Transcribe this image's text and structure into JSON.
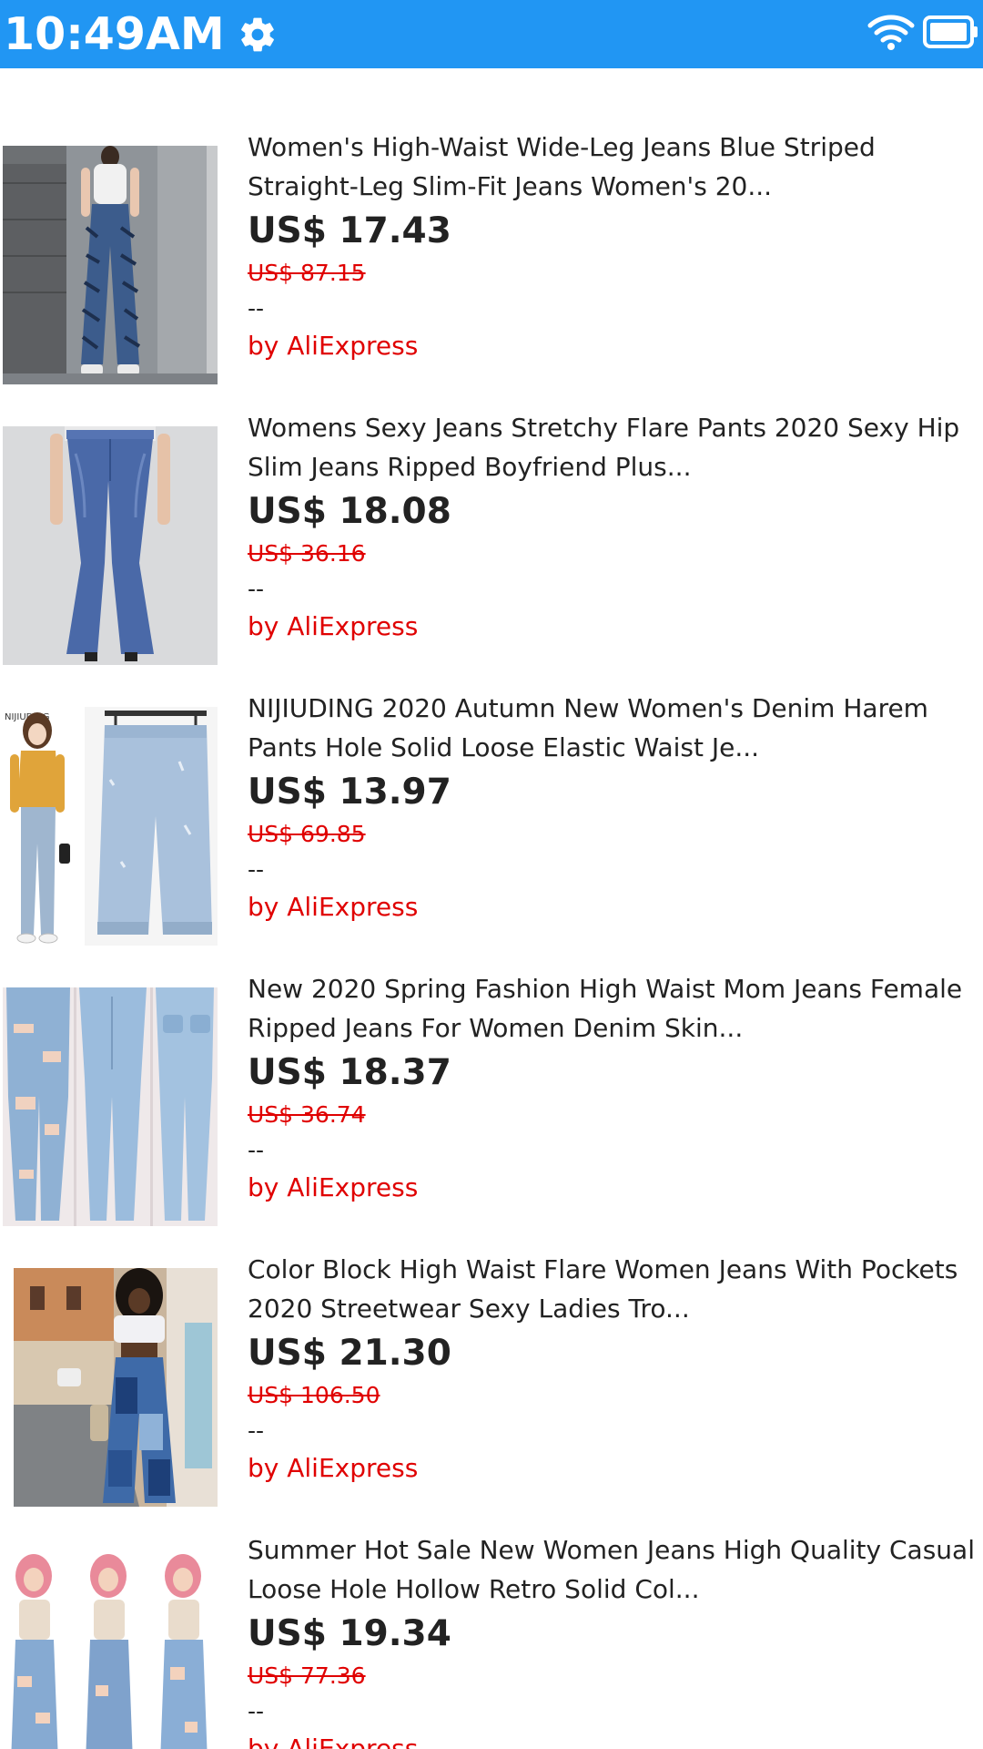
{
  "status_bar": {
    "time": "10:49AM",
    "color": "#2196F3"
  },
  "products": [
    {
      "title": "Women's High-Waist Wide-Leg Jeans Blue Striped Straight-Leg Slim-Fit Jeans Women's 20...",
      "price": "US$ 17.43",
      "original_price": "US$ 87.15",
      "rating": "--",
      "seller": "by AliExpress"
    },
    {
      "title": "Womens Sexy Jeans Stretchy Flare Pants 2020 Sexy Hip Slim Jeans Ripped Boyfriend Plus...",
      "price": "US$ 18.08",
      "original_price": "US$ 36.16",
      "rating": "--",
      "seller": "by AliExpress"
    },
    {
      "title": "NIJIUDING 2020 Autumn New Women's Denim Harem Pants Hole Solid Loose Elastic Waist Je...",
      "price": "US$ 13.97",
      "original_price": "US$ 69.85",
      "rating": "--",
      "seller": "by AliExpress",
      "image_text": "NIJIUDING"
    },
    {
      "title": "New 2020 Spring Fashion High Waist Mom Jeans Female Ripped Jeans For Women Denim Skin...",
      "price": "US$ 18.37",
      "original_price": "US$ 36.74",
      "rating": "--",
      "seller": "by AliExpress"
    },
    {
      "title": "Color Block High Waist Flare Women Jeans With Pockets 2020 Streetwear Sexy Ladies Tro...",
      "price": "US$ 21.30",
      "original_price": "US$ 106.50",
      "rating": "--",
      "seller": "by AliExpress"
    },
    {
      "title": "Summer Hot Sale New Women Jeans High Quality Casual Loose Hole Hollow Retro Solid Col...",
      "price": "US$ 19.34",
      "original_price": "US$ 77.36",
      "rating": "--",
      "seller": "by AliExpress"
    }
  ]
}
